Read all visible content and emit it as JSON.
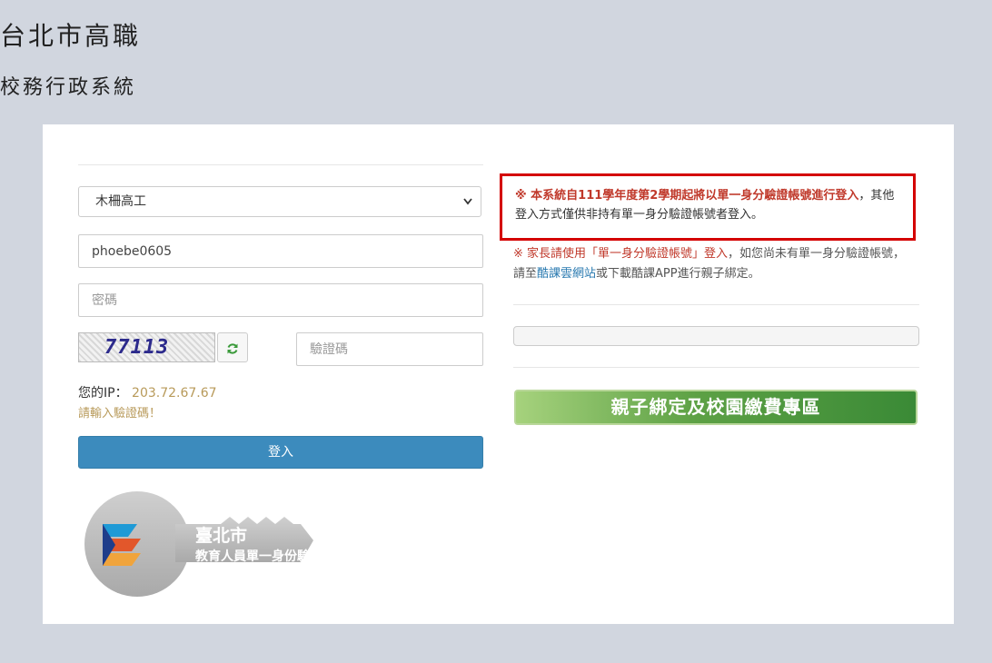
{
  "header": {
    "title": "台北市高職",
    "subtitle": "校務行政系統"
  },
  "login": {
    "school_selected": "木柵高工",
    "username_value": "phoebe0605",
    "password_placeholder": "密碼",
    "captcha_text": "77113",
    "captcha_placeholder": "驗證碼",
    "ip_label": "您的IP：",
    "ip_value": "203.72.67.67",
    "captcha_warning": "請輸入驗證碼！",
    "login_label": "登入"
  },
  "logo": {
    "line1": "臺北市",
    "line2": "教育人員單一身份驗證"
  },
  "notice": {
    "prefix": "※ ",
    "red_text": "本系統自111學年度第2學期起將以單一身分驗證帳號進行登入",
    "rest": "，其他登入方式僅供非持有單一身分驗證帳號者登入。"
  },
  "parent_notice": {
    "prefix": "※ 家長請使用「單一身分驗證帳號」登入",
    "mid": "，如您尚未有單一身分驗證帳號，請至",
    "link": "酷課雲網站",
    "suffix": "或下載酷課APP進行親子綁定。"
  },
  "parent_button": {
    "label": "親子綁定及校園繳費專區"
  },
  "colors": {
    "background": "#d1d6df",
    "login_button": "#3c8bbd",
    "notice_border": "#d40000",
    "green_button": "#5da145"
  },
  "icons": {
    "refresh": "refresh-icon",
    "dropdown": "chevron-down-icon"
  }
}
